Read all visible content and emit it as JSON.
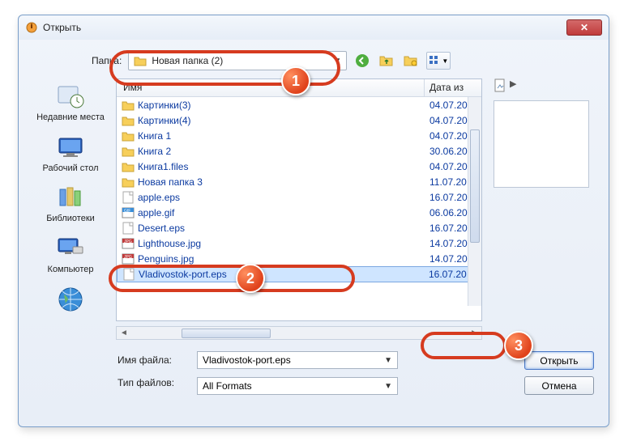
{
  "title": "Открыть",
  "top": {
    "folder_label": "Папка:",
    "folder_value": "Новая папка (2)"
  },
  "places": {
    "recent": "Недавние места",
    "desktop": "Рабочий стол",
    "libraries": "Библиотеки",
    "computer": "Компьютер"
  },
  "columns": {
    "name": "Имя",
    "date": "Дата из"
  },
  "files": [
    {
      "name": "Картинки(3)",
      "date": "04.07.20",
      "type": "folder"
    },
    {
      "name": "Картинки(4)",
      "date": "04.07.20",
      "type": "folder"
    },
    {
      "name": "Книга 1",
      "date": "04.07.20",
      "type": "folder"
    },
    {
      "name": "Книга 2",
      "date": "30.06.20",
      "type": "folder"
    },
    {
      "name": "Книга1.files",
      "date": "04.07.20",
      "type": "folder"
    },
    {
      "name": "Новая папка 3",
      "date": "11.07.20",
      "type": "folder"
    },
    {
      "name": "apple.eps",
      "date": "16.07.20",
      "type": "eps"
    },
    {
      "name": "apple.gif",
      "date": "06.06.20",
      "type": "gif"
    },
    {
      "name": "Desert.eps",
      "date": "16.07.20",
      "type": "eps"
    },
    {
      "name": "Lighthouse.jpg",
      "date": "14.07.20",
      "type": "jpg"
    },
    {
      "name": "Penguins.jpg",
      "date": "14.07.20",
      "type": "jpg"
    },
    {
      "name": "Vladivostok-port.eps",
      "date": "16.07.20",
      "type": "eps",
      "selected": true
    }
  ],
  "filename_label": "Имя файла:",
  "filetype_label": "Тип файлов:",
  "filename_value": "Vladivostok-port.eps",
  "filetype_value": "All Formats",
  "buttons": {
    "open": "Открыть",
    "cancel": "Отмена"
  },
  "badges": {
    "b1": "1",
    "b2": "2",
    "b3": "3"
  }
}
